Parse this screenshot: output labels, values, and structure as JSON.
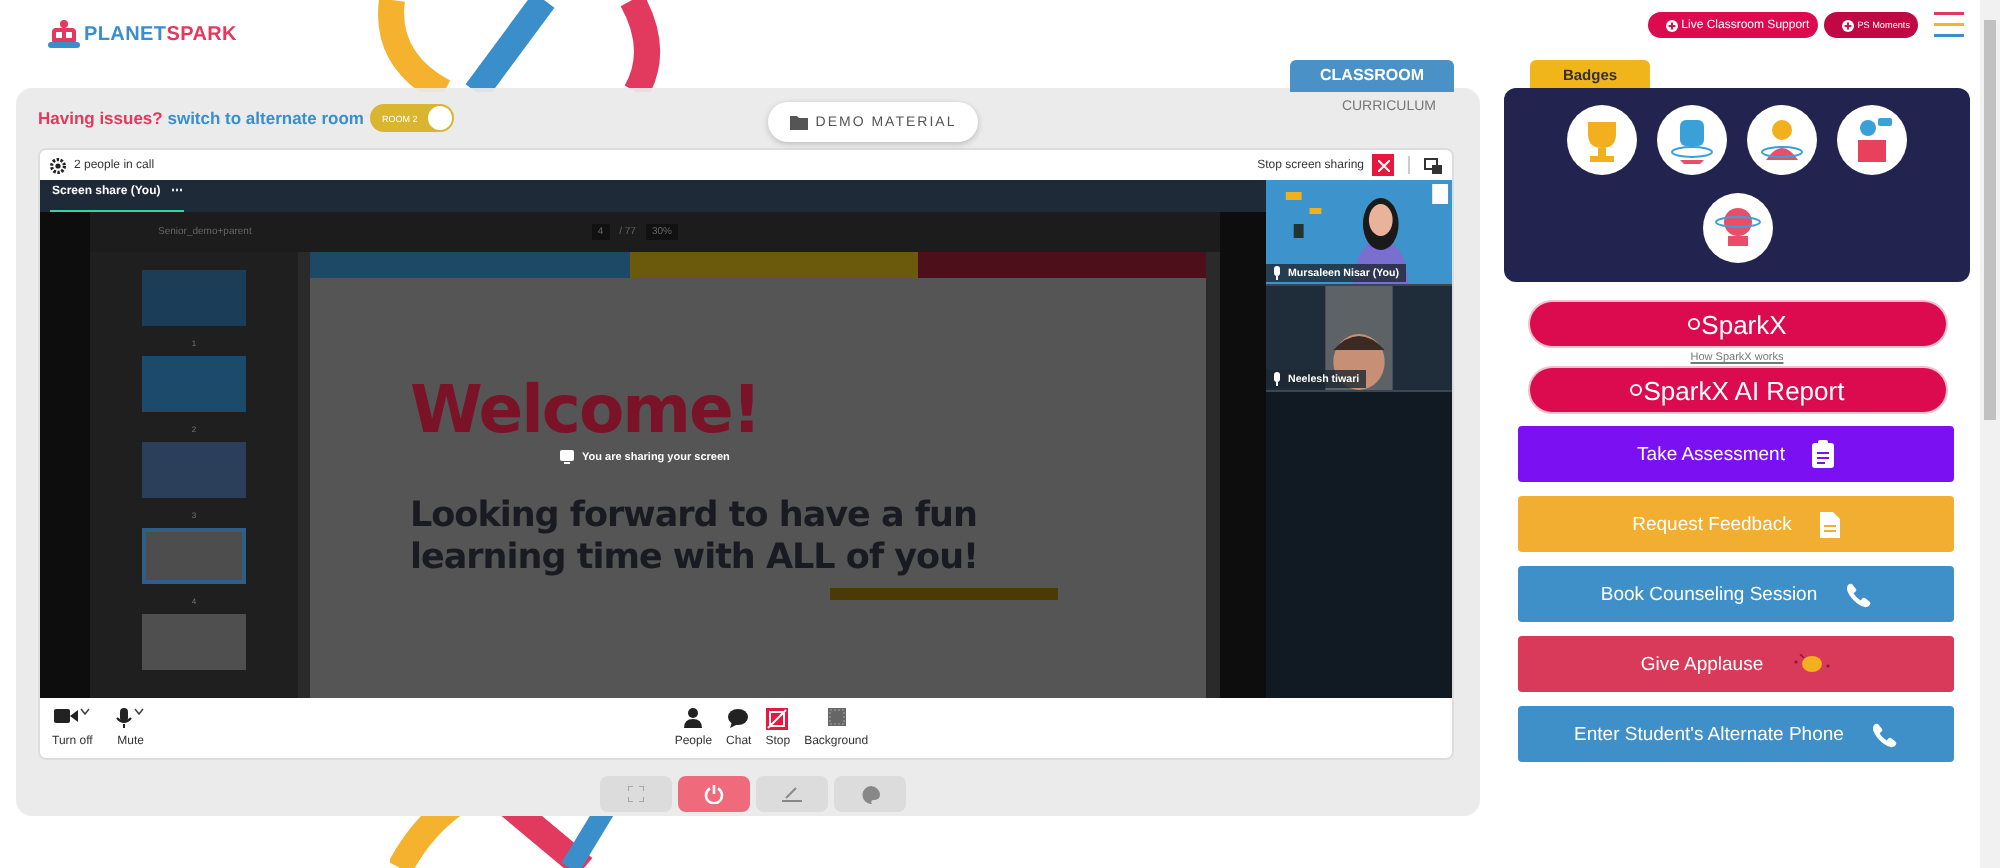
{
  "logo": {
    "text_parts": [
      "PLANET",
      "SPARK"
    ]
  },
  "header_buttons": [
    {
      "label": "Live Classroom Support"
    },
    {
      "label": "PS Moments"
    }
  ],
  "notice": {
    "question": "Having issues?",
    "link": "switch to alternate room"
  },
  "room_toggle": {
    "label": "ROOM 2",
    "on": true
  },
  "demo_button": "DEMO MATERIAL",
  "tabs": [
    {
      "label": "CLASSROOM",
      "selected": true
    },
    {
      "label": "CURRICULUM",
      "selected": false
    }
  ],
  "call": {
    "people": "2 people in call",
    "stop_sharing": "Stop screen sharing",
    "share_label": "Screen share (You)",
    "share_menu": "⋯",
    "sharing_notice": "You are sharing your screen"
  },
  "pdf": {
    "file": "Senior_demo+parent",
    "page": "4",
    "pages": "/ 77",
    "zoom": "30%",
    "thumbnails": [
      {
        "number": "1",
        "selected": false
      },
      {
        "number": "2",
        "selected": false
      },
      {
        "number": "3",
        "selected": false
      },
      {
        "number": "4",
        "selected": true
      },
      {
        "selected": false
      }
    ],
    "slide_title": "Welcome!",
    "slide_text": "Looking forward to have a fun learning time with ALL of you!"
  },
  "participants": [
    {
      "name": "Mursaleen Nisar (You)",
      "kind": "self"
    },
    {
      "name": "Neelesh tiwari",
      "kind": "guest"
    }
  ],
  "toolbar_left": [
    {
      "label": "Turn off",
      "kind": "camera"
    },
    {
      "label": "Mute",
      "kind": "mic"
    }
  ],
  "toolbar_center": [
    {
      "label": "People",
      "kind": "people"
    },
    {
      "label": "Chat",
      "kind": "chat"
    },
    {
      "label": "Stop",
      "kind": "stop"
    },
    {
      "label": "Background",
      "kind": "background"
    }
  ],
  "controls": [
    {
      "kind": "fullscreen"
    },
    {
      "kind": "power"
    },
    {
      "kind": "pen"
    },
    {
      "kind": "palette"
    }
  ],
  "badges": {
    "title": "Badges",
    "items": [
      {
        "kind": "trophy"
      },
      {
        "kind": "fist"
      },
      {
        "kind": "hero"
      },
      {
        "kind": "speaker"
      },
      {
        "kind": "brain"
      }
    ]
  },
  "sparkx": {
    "buttons": [
      "SparkX",
      "SparkX AI Report"
    ],
    "link": "How SparkX works"
  },
  "actions": [
    {
      "label": "Take Assessment",
      "color": "#7b10f2",
      "kind": "clipboard"
    },
    {
      "label": "Request Feedback",
      "color": "#f2ae30",
      "kind": "document"
    },
    {
      "label": "Book Counseling Session",
      "color": "#3f90c8",
      "kind": "phone"
    },
    {
      "label": "Give Applause",
      "color": "#d93a5a",
      "kind": "clap"
    },
    {
      "label": "Enter Student's Alternate Phone",
      "color": "#3f90c8",
      "kind": "phone"
    }
  ]
}
